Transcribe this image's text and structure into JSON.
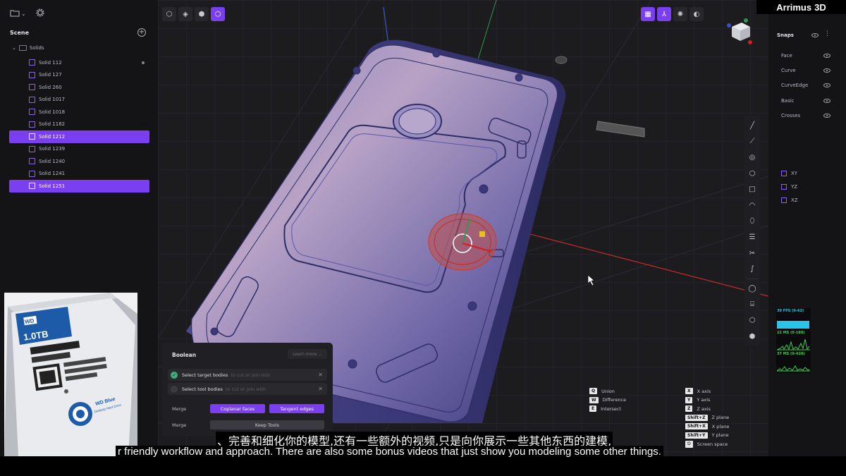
{
  "brand": {
    "name": "Arrimus",
    "suffix": "3D"
  },
  "scene_panel": {
    "title": "Scene",
    "group": "Solids",
    "items": [
      {
        "label": "Solid 112",
        "selected": false
      },
      {
        "label": "Solid 127",
        "selected": false
      },
      {
        "label": "Solid 260",
        "selected": false
      },
      {
        "label": "Solid 1017",
        "selected": false
      },
      {
        "label": "Solid 1018",
        "selected": false
      },
      {
        "label": "Solid 1182",
        "selected": false
      },
      {
        "label": "Solid 1212",
        "selected": true
      },
      {
        "label": "Solid 1239",
        "selected": false
      },
      {
        "label": "Solid 1240",
        "selected": false
      },
      {
        "label": "Solid 1241",
        "selected": false
      },
      {
        "label": "Solid 1251",
        "selected": true
      }
    ]
  },
  "reference_photo": {
    "brand": "WD",
    "capacity": "1.0TB",
    "product": "WD Blue",
    "product_sub": "Desktop Hard Drive"
  },
  "boolean_panel": {
    "title": "Boolean",
    "learn_more": "Learn more ...",
    "target": {
      "label": "Select target bodies",
      "hint": "to cut or join into"
    },
    "tool": {
      "label": "Select tool bodies",
      "hint": "to cut or join with"
    },
    "merge1_label": "Merge",
    "coplanar": "Coplanar faces",
    "tangent": "Tangent edges",
    "merge2_label": "Merge",
    "keep_tools": "Keep Tools"
  },
  "shortcuts_left": [
    {
      "key": "Q",
      "label": "Union"
    },
    {
      "key": "W",
      "label": "Difference"
    },
    {
      "key": "E",
      "label": "Intersect"
    }
  ],
  "shortcuts_right": [
    {
      "key": "X",
      "label": "X axis"
    },
    {
      "key": "Y",
      "label": "Y axis"
    },
    {
      "key": "Z",
      "label": "Z axis"
    },
    {
      "key": "Shift+Z",
      "label": "Z plane"
    },
    {
      "key": "Shift+X",
      "label": "X plane"
    },
    {
      "key": "Shift+Y",
      "label": "Y plane"
    },
    {
      "key": "⎋",
      "label": "Screen space"
    }
  ],
  "snaps_panel": {
    "title": "Snaps",
    "items": [
      "Face",
      "Curve",
      "CurveEdge",
      "Basic",
      "Crosses"
    ],
    "planes": [
      "XY",
      "YZ",
      "XZ"
    ]
  },
  "perf": {
    "fps": "39 FPS (0-62)",
    "ms1": "22 MS (0-188)",
    "ms2": "37 MS (0-420)"
  },
  "subtitles": {
    "zh": "、完善和细化你的模型,还有一些额外的视频,只是向你展示一些其他东西的建模,",
    "en": "r friendly workflow and approach. There are also some bonus videos that just show you modeling some other things."
  },
  "colors": {
    "accent": "#7b3ff2",
    "panel": "#141417",
    "viewport": "#1c1c1f"
  }
}
